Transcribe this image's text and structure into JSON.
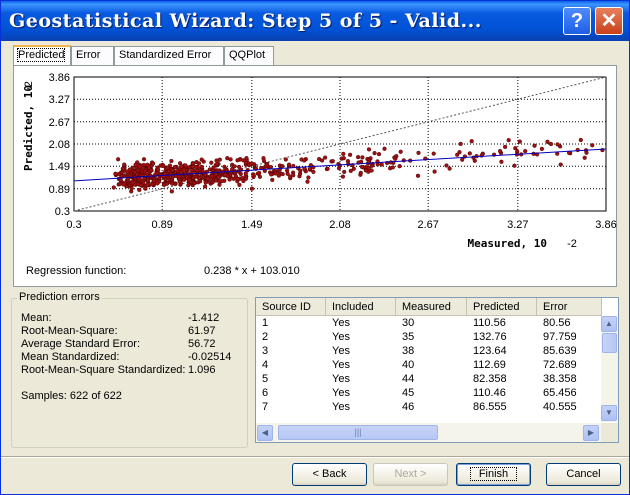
{
  "window": {
    "title": "Geostatistical Wizard: Step 5 of 5 - Valid..."
  },
  "titlebar_buttons": {
    "help": "?",
    "close": "✕"
  },
  "tabs": [
    {
      "label": "Predicted",
      "active": true
    },
    {
      "label": "Error",
      "active": false
    },
    {
      "label": "Standardized Error",
      "active": false
    },
    {
      "label": "QQPlot",
      "active": false
    }
  ],
  "chart_data": {
    "type": "scatter",
    "xlabel": "Measured, 10",
    "xlabel_exp": "-2",
    "ylabel": "Predicted, 10",
    "ylabel_exp": "-2",
    "x_ticks": [
      "0.3",
      "0.89",
      "1.49",
      "2.08",
      "2.67",
      "3.27",
      "3.86"
    ],
    "y_ticks": [
      "3.86",
      "3.27",
      "2.67",
      "2.08",
      "1.49",
      "0.89",
      "0.3"
    ],
    "xlim": [
      0.3,
      3.86
    ],
    "ylim": [
      0.3,
      3.86
    ],
    "grid": true,
    "regression_line": {
      "slope": 0.238,
      "intercept": 1.0301,
      "color": "#0000c0"
    },
    "reference_line": {
      "slope": 1,
      "intercept": 0,
      "style": "dashed"
    },
    "point_color": "#a01010",
    "point_count": 622
  },
  "regression": {
    "label": "Regression function:",
    "value": "0.238 * x + 103.010"
  },
  "prediction_errors": {
    "title": "Prediction errors",
    "stats": [
      {
        "label": "Mean:",
        "value": "-1.412"
      },
      {
        "label": "Root-Mean-Square:",
        "value": "61.97"
      },
      {
        "label": "Average Standard Error:",
        "value": "56.72"
      },
      {
        "label": "Mean Standardized:",
        "value": "-0.02514"
      },
      {
        "label": "Root-Mean-Square Standardized:",
        "value": "1.096"
      }
    ],
    "samples": "Samples: 622 of 622"
  },
  "table": {
    "columns": [
      "Source ID",
      "Included",
      "Measured",
      "Predicted",
      "Error"
    ],
    "rows": [
      [
        "1",
        "Yes",
        "30",
        "110.56",
        "80.56"
      ],
      [
        "2",
        "Yes",
        "35",
        "132.76",
        "97.759"
      ],
      [
        "3",
        "Yes",
        "38",
        "123.64",
        "85.639"
      ],
      [
        "4",
        "Yes",
        "40",
        "112.69",
        "72.689"
      ],
      [
        "5",
        "Yes",
        "44",
        "82.358",
        "38.358"
      ],
      [
        "6",
        "Yes",
        "45",
        "110.46",
        "65.456"
      ],
      [
        "7",
        "Yes",
        "46",
        "86.555",
        "40.555"
      ]
    ],
    "hscroll_grip": "|||"
  },
  "buttons": {
    "back": "< Back",
    "next": "Next >",
    "finish": "Finish",
    "cancel": "Cancel"
  }
}
